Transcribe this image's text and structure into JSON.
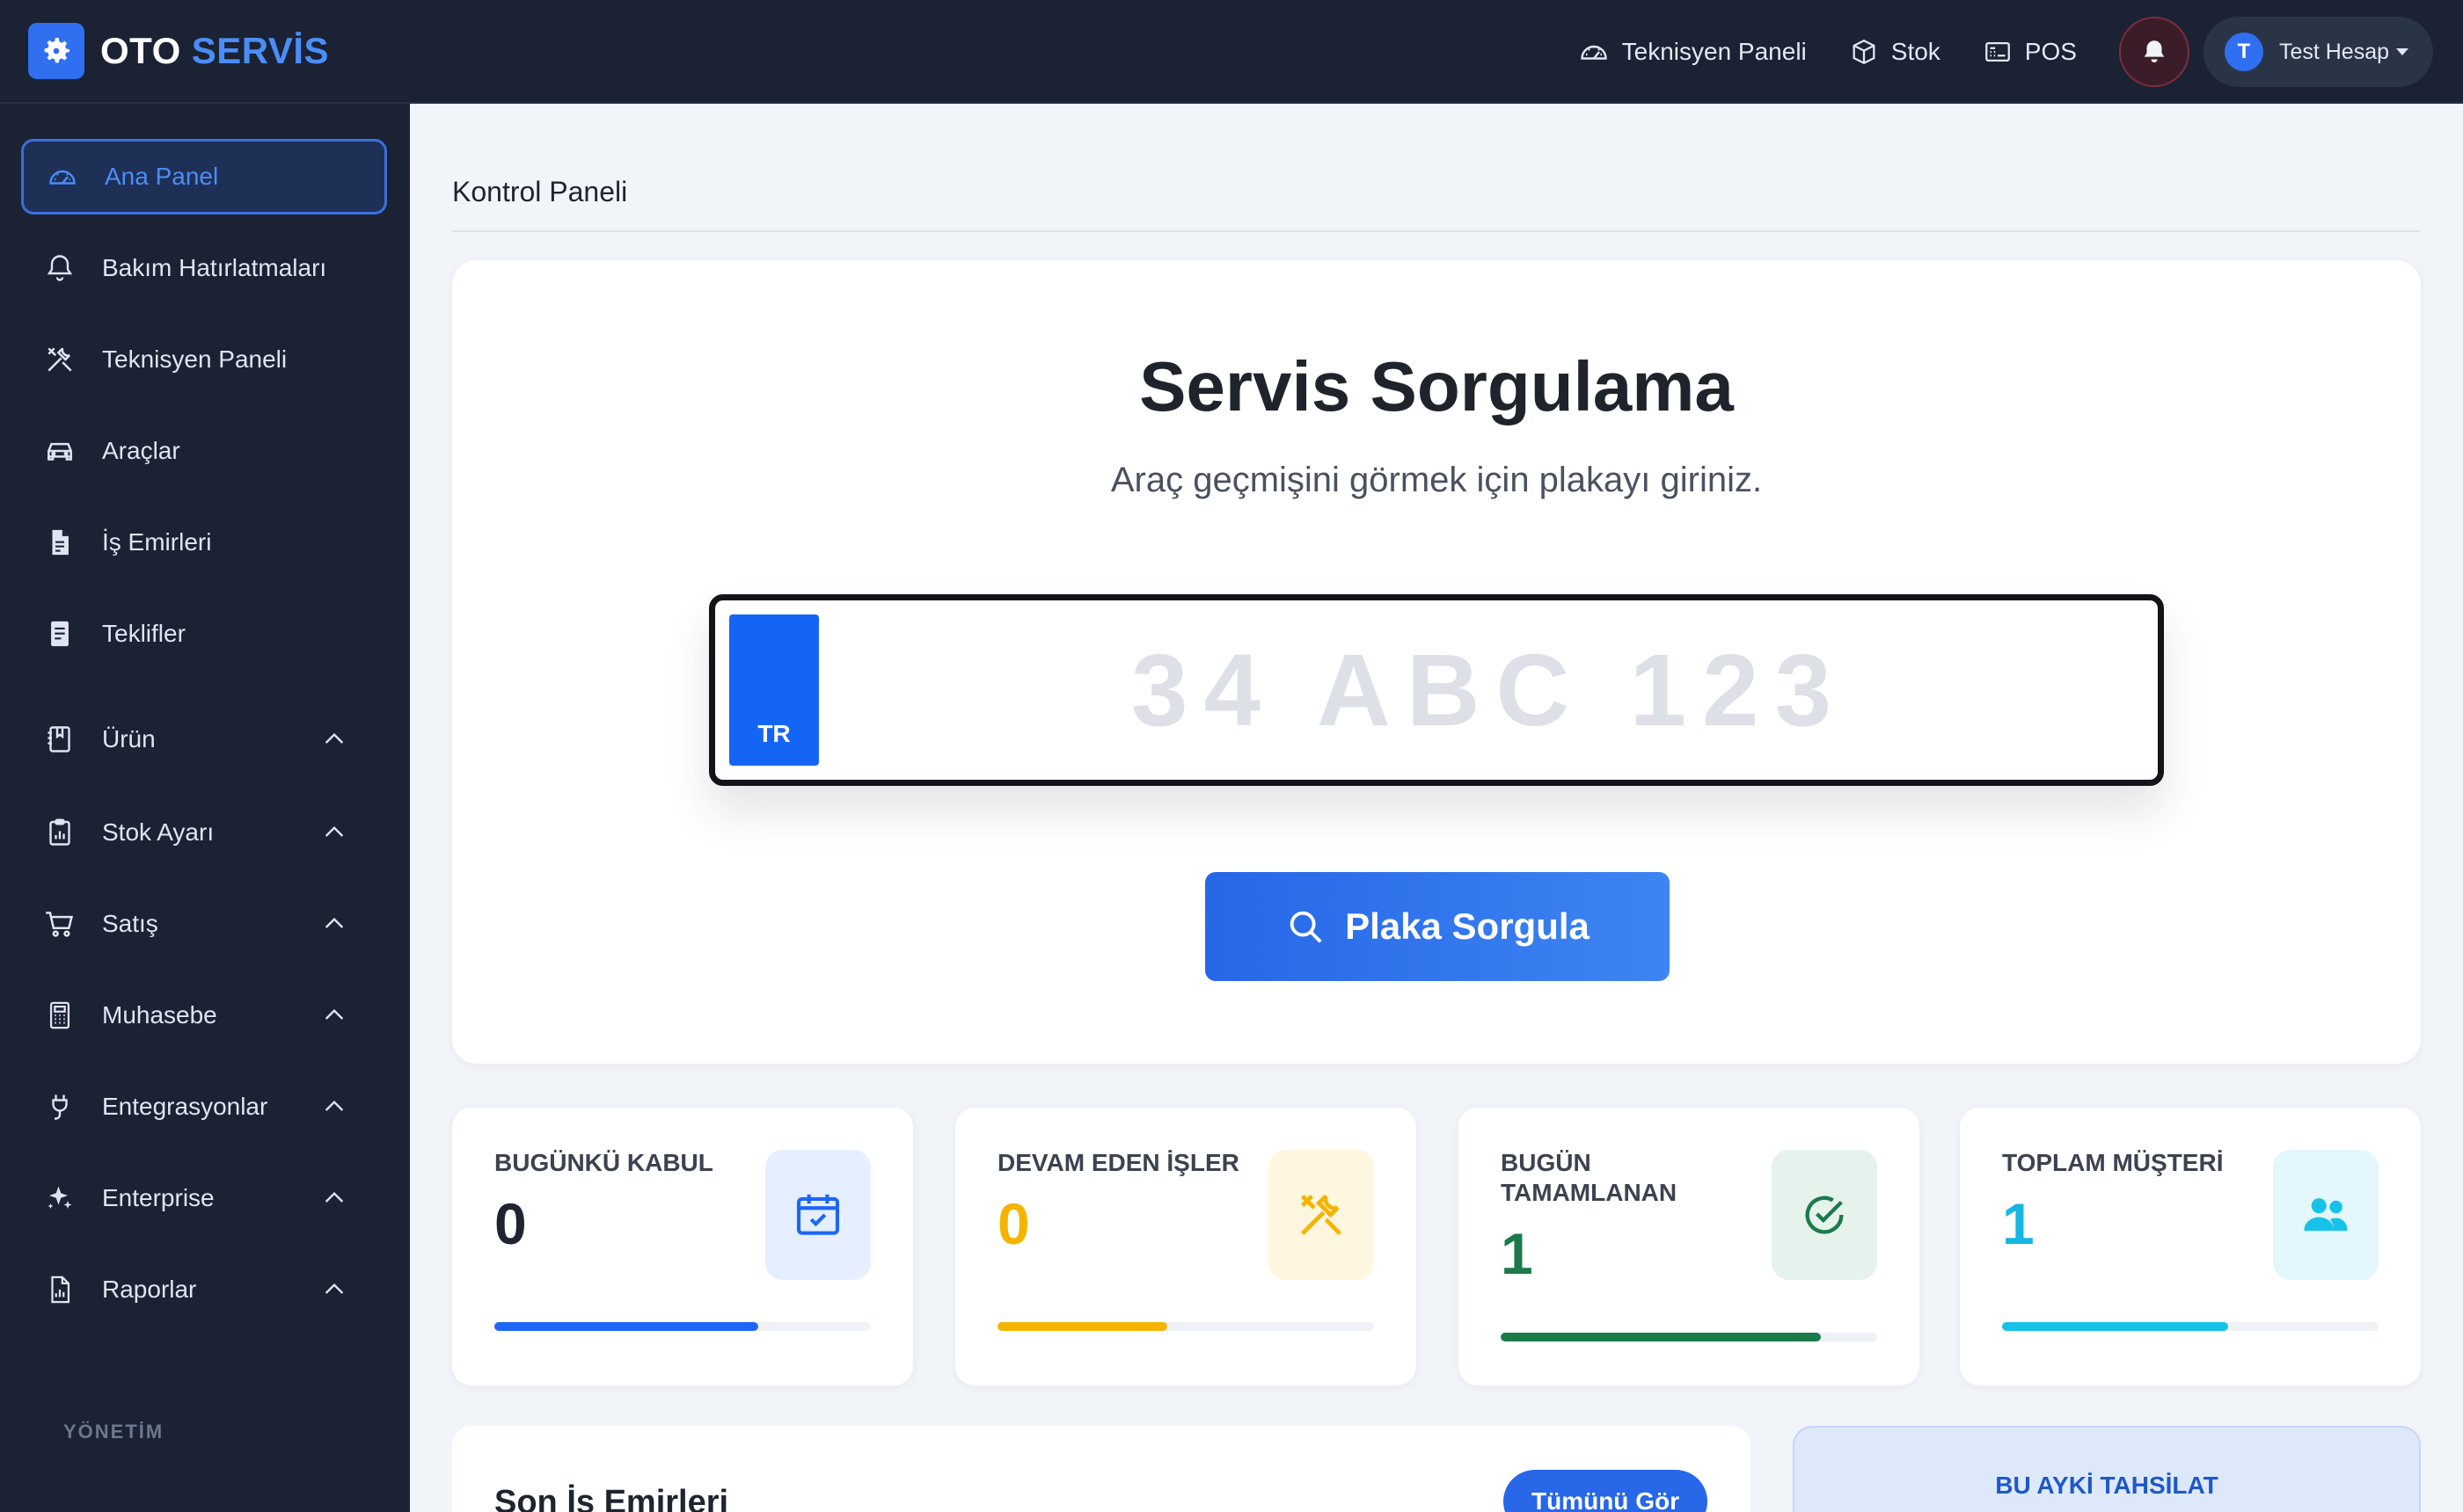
{
  "brand": {
    "part1": "OTO",
    "part2": "SERVİS"
  },
  "topnav": {
    "technician": "Teknisyen Paneli",
    "stock": "Stok",
    "pos": "POS",
    "user_initial": "T",
    "user_name": "Test Hesap"
  },
  "sidebar": {
    "items": [
      {
        "label": "Ana Panel",
        "icon": "gauge-icon",
        "active": true
      },
      {
        "label": "Bakım Hatırlatmaları",
        "icon": "bell-icon"
      },
      {
        "label": "Teknisyen Paneli",
        "icon": "tools-icon"
      },
      {
        "label": "Araçlar",
        "icon": "car-icon"
      },
      {
        "label": "İş Emirleri",
        "icon": "document-icon"
      },
      {
        "label": "Teklifler",
        "icon": "file-text-icon"
      },
      {
        "label": "Ürün",
        "icon": "book-icon",
        "expandable": true
      },
      {
        "label": "Stok Ayarı",
        "icon": "clipboard-chart-icon",
        "expandable": true
      },
      {
        "label": "Satış",
        "icon": "cart-icon",
        "expandable": true
      },
      {
        "label": "Muhasebe",
        "icon": "calculator-icon",
        "expandable": true
      },
      {
        "label": "Entegrasyonlar",
        "icon": "plug-icon",
        "expandable": true
      },
      {
        "label": "Enterprise",
        "icon": "sparkle-icon",
        "expandable": true
      },
      {
        "label": "Raporlar",
        "icon": "report-icon",
        "expandable": true
      }
    ],
    "section_label": "YÖNETİM"
  },
  "breadcrumb": "Kontrol Paneli",
  "hero": {
    "title": "Servis Sorgulama",
    "subtitle": "Araç geçmişini görmek için plakayı giriniz.",
    "plate_country": "TR",
    "plate_placeholder": "34 ABC 123",
    "plate_value": "",
    "button_label": "Plaka Sorgula"
  },
  "stats": [
    {
      "label": "BUGÜNKÜ KABUL",
      "value": "0",
      "color": "#1e2530",
      "accent": "#1e66f5",
      "icon": "calendar-check-icon",
      "progress": 0.7
    },
    {
      "label": "DEVAM EDEN İŞLER",
      "value": "0",
      "color": "#f4b400",
      "accent": "#f4b400",
      "icon": "tools-icon",
      "progress": 0.45
    },
    {
      "label": "BUGÜN TAMAMLANAN",
      "value": "1",
      "color": "#1c7a4a",
      "accent": "#1c7a4a",
      "icon": "check-circle-icon",
      "progress": 0.85
    },
    {
      "label": "TOPLAM MÜŞTERİ",
      "value": "1",
      "color": "#16b5e2",
      "accent": "#16c2e8",
      "icon": "users-icon",
      "progress": 0.6
    }
  ],
  "orders": {
    "title": "Son İş Emirleri",
    "view_all": "Tümünü Gör"
  },
  "collection": {
    "title": "BU AYKİ TAHSİLAT"
  },
  "colors": {
    "sidebar_bg": "#1a2234",
    "accent": "#2f6ff0",
    "page_bg": "#f1f4f9"
  }
}
